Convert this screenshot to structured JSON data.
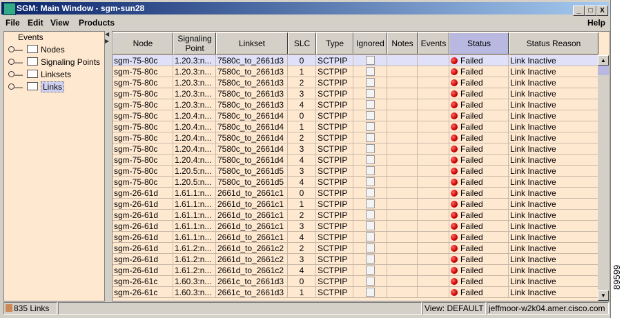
{
  "window": {
    "title": "SGM: Main Window - sgm-sun28",
    "min": "_",
    "max": "□",
    "close": "X"
  },
  "menu": {
    "file": "File",
    "edit": "Edit",
    "view": "View",
    "products": "Products",
    "help": "Help"
  },
  "tree": {
    "root": "Events",
    "items": [
      "Nodes",
      "Signaling Points",
      "Linksets",
      "Links"
    ],
    "selected": "Links"
  },
  "table": {
    "columns": [
      "Node",
      "Signaling Point",
      "Linkset",
      "SLC",
      "Type",
      "Ignored",
      "Notes",
      "Events",
      "Status",
      "Status Reason"
    ],
    "rows": [
      [
        "sgm-75-80c",
        "1.20.3:n...",
        "7580c_to_2661d3",
        "0"
      ],
      [
        "sgm-75-80c",
        "1.20.3:n...",
        "7580c_to_2661d3",
        "1"
      ],
      [
        "sgm-75-80c",
        "1.20.3:n...",
        "7580c_to_2661d3",
        "2"
      ],
      [
        "sgm-75-80c",
        "1.20.3:n...",
        "7580c_to_2661d3",
        "3"
      ],
      [
        "sgm-75-80c",
        "1.20.3:n...",
        "7580c_to_2661d3",
        "4"
      ],
      [
        "sgm-75-80c",
        "1.20.4:n...",
        "7580c_to_2661d4",
        "0"
      ],
      [
        "sgm-75-80c",
        "1.20.4:n...",
        "7580c_to_2661d4",
        "1"
      ],
      [
        "sgm-75-80c",
        "1.20.4:n...",
        "7580c_to_2661d4",
        "2"
      ],
      [
        "sgm-75-80c",
        "1.20.4:n...",
        "7580c_to_2661d4",
        "3"
      ],
      [
        "sgm-75-80c",
        "1.20.4:n...",
        "7580c_to_2661d4",
        "4"
      ],
      [
        "sgm-75-80c",
        "1.20.5:n...",
        "7580c_to_2661d5",
        "3"
      ],
      [
        "sgm-75-80c",
        "1.20.5:n...",
        "7580c_to_2661d5",
        "4"
      ],
      [
        "sgm-26-61d",
        "1.61.1:n...",
        "2661d_to_2661c1",
        "0"
      ],
      [
        "sgm-26-61d",
        "1.61.1:n...",
        "2661d_to_2661c1",
        "1"
      ],
      [
        "sgm-26-61d",
        "1.61.1:n...",
        "2661d_to_2661c1",
        "2"
      ],
      [
        "sgm-26-61d",
        "1.61.1:n...",
        "2661d_to_2661c1",
        "3"
      ],
      [
        "sgm-26-61d",
        "1.61.1:n...",
        "2661d_to_2661c1",
        "4"
      ],
      [
        "sgm-26-61d",
        "1.61.2:n...",
        "2661d_to_2661c2",
        "2"
      ],
      [
        "sgm-26-61d",
        "1.61.2:n...",
        "2661d_to_2661c2",
        "3"
      ],
      [
        "sgm-26-61d",
        "1.61.2:n...",
        "2661d_to_2661c2",
        "4"
      ],
      [
        "sgm-26-61c",
        "1.60.3:n...",
        "2661c_to_2661d3",
        "0"
      ],
      [
        "sgm-26-61c",
        "1.60.3:n...",
        "2661c_to_2661d3",
        "1"
      ]
    ],
    "type": "SCTPIP",
    "status": "Failed",
    "reason": "Link Inactive",
    "status_color": "#cc0000"
  },
  "statusbar": {
    "count": "835 Links",
    "view": "View: DEFAULT",
    "host": "jeffmoor-w2k04.amer.cisco.com"
  },
  "figure_id": "89599"
}
